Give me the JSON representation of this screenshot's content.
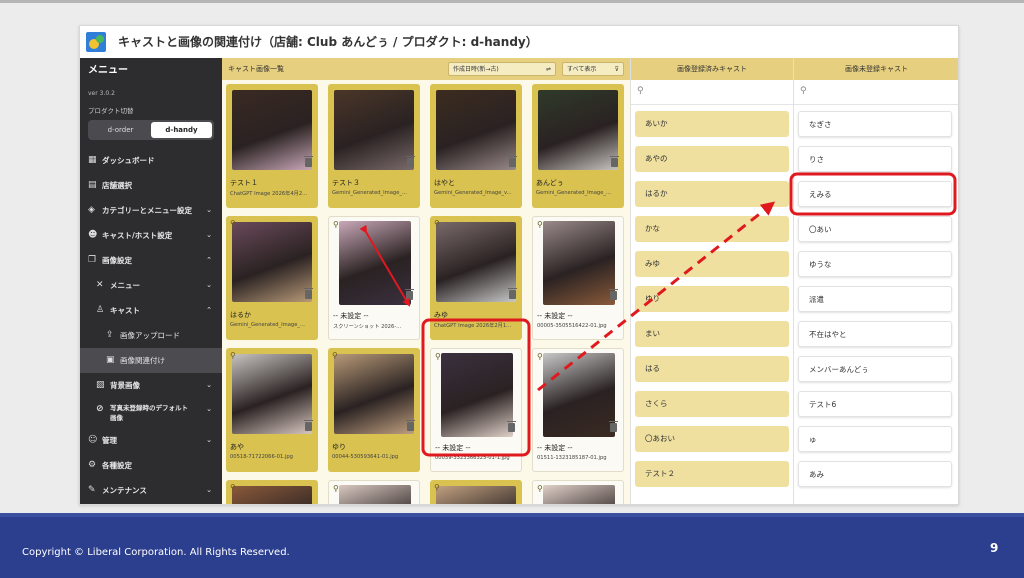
{
  "window": {
    "title": "キャストと画像の関連付け（店舗: Club あんどぅ / プロダクト: d-handy）"
  },
  "sidebar": {
    "header": "メニュー",
    "version": "ver 3.0.2",
    "product_label": "プロダクト切替",
    "products": [
      "d-order",
      "d-handy"
    ],
    "items": [
      {
        "label": "ダッシュボード",
        "icon": "dashboard-icon",
        "glyph": "▦"
      },
      {
        "label": "店舗選択",
        "icon": "store-icon",
        "glyph": "▤"
      },
      {
        "label": "カテゴリーとメニュー設定",
        "icon": "tag-icon",
        "glyph": "◈"
      },
      {
        "label": "キャスト/ホスト設定",
        "icon": "people-icon",
        "glyph": "☻"
      },
      {
        "label": "画像設定",
        "icon": "images-icon",
        "glyph": "❐"
      },
      {
        "label": "メニュー",
        "icon": "utensils-icon",
        "glyph": "✕"
      },
      {
        "label": "キャスト",
        "icon": "person-icon",
        "glyph": "♙"
      },
      {
        "label": "画像アップロード",
        "icon": "upload-icon",
        "glyph": "⇪"
      },
      {
        "label": "画像関連付け",
        "icon": "link-icon",
        "glyph": "▣"
      },
      {
        "label": "背景画像",
        "icon": "picture-icon",
        "glyph": "▨"
      },
      {
        "label": "写真未登録時のデフォルト画像",
        "icon": "no-image-icon",
        "glyph": "⊘"
      },
      {
        "label": "管理",
        "icon": "admin-icon",
        "glyph": "☺"
      },
      {
        "label": "各種設定",
        "icon": "gear-icon",
        "glyph": "⚙"
      },
      {
        "label": "メンテナンス",
        "icon": "wrench-icon",
        "glyph": "✎"
      }
    ]
  },
  "gallery": {
    "title": "キャスト画像一覧",
    "sort": "作成日時(新→古)",
    "filter": "すべて表示",
    "cards": [
      {
        "name": "テスト１",
        "file": "ChatGPT Image 2026年4月2...",
        "linked": true
      },
      {
        "name": "テスト３",
        "file": "Gemini_Generated_Image_...",
        "linked": true
      },
      {
        "name": "はやと",
        "file": "Gemini_Generated_Image_v...",
        "linked": true
      },
      {
        "name": "あんどぅ",
        "file": "Gemini_Generated_Image_...",
        "linked": true
      },
      {
        "name": "はるか",
        "file": "Gemini_Generated_Image_...",
        "linked": true
      },
      {
        "name": "-- 未設定 --",
        "file": "スクリーンショット 2026-...",
        "linked": false
      },
      {
        "name": "みゆ",
        "file": "ChatGPT Image 2026年2月1...",
        "linked": true
      },
      {
        "name": "-- 未設定 --",
        "file": "00005-3505516422-01.jpg",
        "linked": false
      },
      {
        "name": "あや",
        "file": "00518-71722066-01.jpg",
        "linked": true
      },
      {
        "name": "ゆり",
        "file": "00044-530593641-01.jpg",
        "linked": true
      },
      {
        "name": "-- 未設定 --",
        "file": "00039-3323366325-01-1.jpg",
        "linked": false
      },
      {
        "name": "-- 未設定 --",
        "file": "01511-1323185187-01.jpg",
        "linked": false
      },
      {
        "name": "",
        "file": "",
        "linked": true
      },
      {
        "name": "",
        "file": "",
        "linked": false
      },
      {
        "name": "",
        "file": "",
        "linked": true
      },
      {
        "name": "",
        "file": "",
        "linked": false
      }
    ]
  },
  "registered": {
    "title": "画像登録済みキャスト",
    "search_placeholder": "",
    "items": [
      "あいか",
      "あやの",
      "はるか",
      "かな",
      "みゆ",
      "ゆり",
      "まい",
      "はる",
      "さくら",
      "〇あおい",
      "テスト２"
    ]
  },
  "unregistered": {
    "title": "画像未登録キャスト",
    "search_placeholder": "",
    "items": [
      "なぎさ",
      "りさ",
      "えみる",
      "〇あい",
      "ゆうな",
      "派遣",
      "不在はやと",
      "メンバーあんどぅ",
      "テスト6",
      "ゅ",
      "あみ"
    ]
  },
  "annotations": {
    "highlight_color": "#e0191f"
  },
  "footer": {
    "copyright": "Copyright ©  Liberal Corporation. All Rights Reserved.",
    "page": "9"
  }
}
